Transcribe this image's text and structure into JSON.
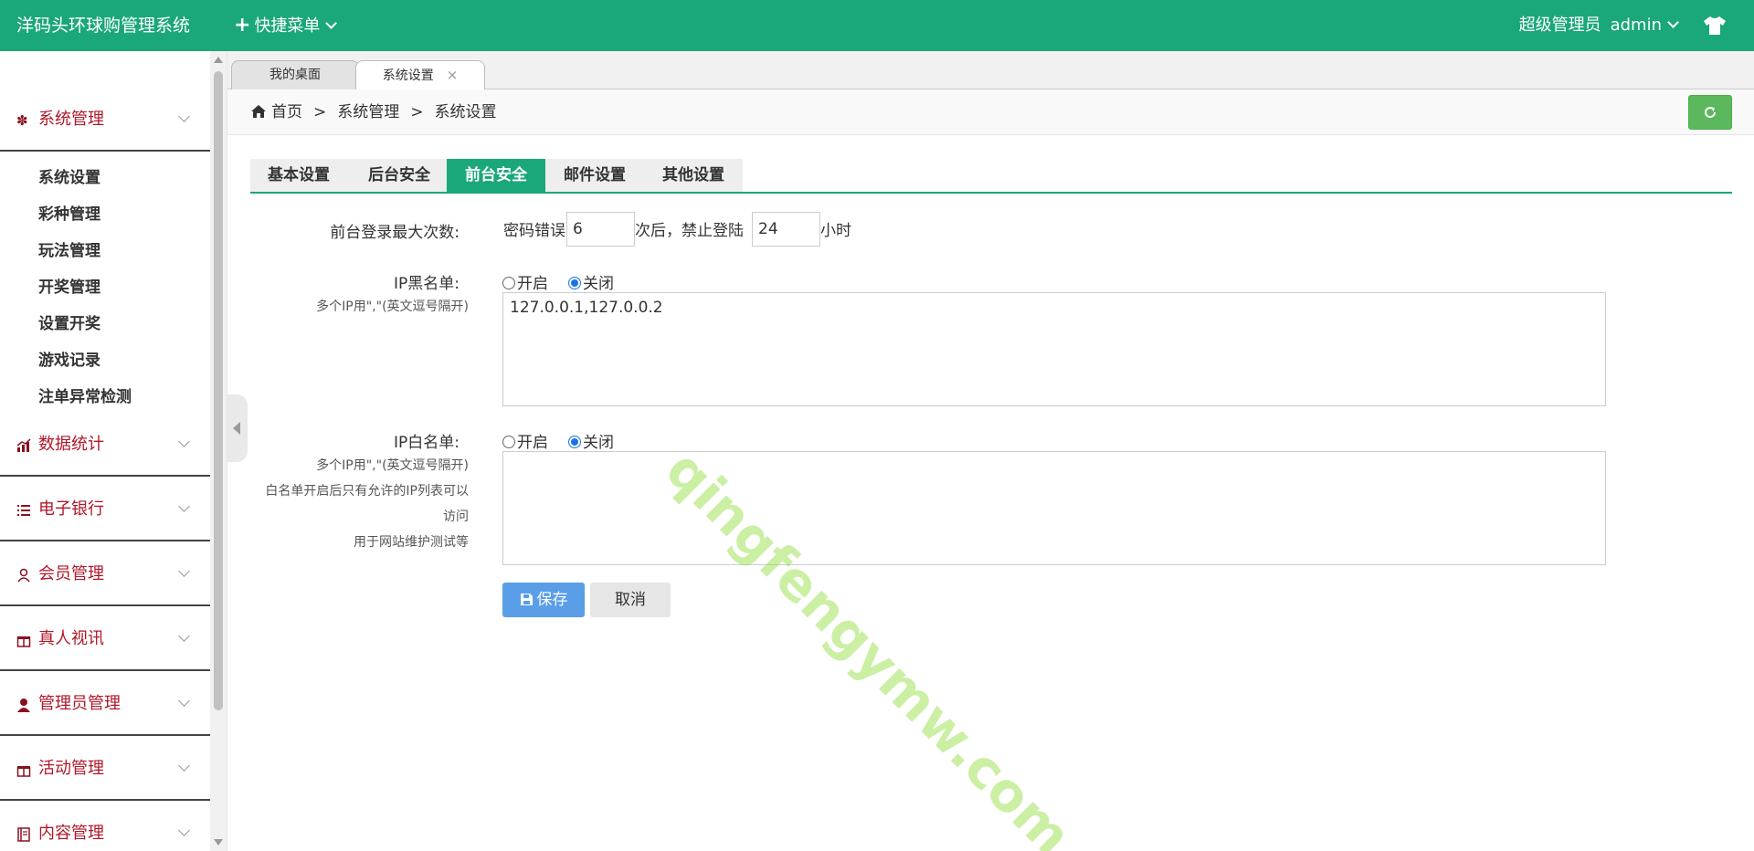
{
  "header": {
    "brand": "洋码头环球购管理系统",
    "quick_menu": "快捷菜单",
    "role": "超级管理员",
    "username": "admin",
    "accent": "#1aa77a"
  },
  "sidebar": {
    "groups": [
      {
        "label": "系统管理",
        "icon": "gear-icon"
      },
      {
        "label": "数据统计",
        "icon": "chart-icon"
      },
      {
        "label": "电子银行",
        "icon": "list-icon"
      },
      {
        "label": "会员管理",
        "icon": "user-icon"
      },
      {
        "label": "真人视讯",
        "icon": "gift-icon"
      },
      {
        "label": "管理员管理",
        "icon": "person-icon"
      },
      {
        "label": "活动管理",
        "icon": "gift-icon"
      },
      {
        "label": "内容管理",
        "icon": "book-icon"
      }
    ],
    "sub_items": [
      "系统设置",
      "彩种管理",
      "玩法管理",
      "开奖管理",
      "设置开奖",
      "游戏记录",
      "注单异常检测"
    ]
  },
  "tabs": [
    {
      "label": "我的桌面"
    },
    {
      "label": "系统设置",
      "close": "×"
    }
  ],
  "breadcrumb": {
    "home": "首页",
    "sep": ">",
    "level1": "系统管理",
    "level2": "系统设置"
  },
  "content_tabs": [
    "基本设置",
    "后台安全",
    "前台安全",
    "邮件设置",
    "其他设置"
  ],
  "form": {
    "login_max_label": "前台登录最大次数:",
    "pwd_error_prefix": "密码错误",
    "pwd_error_count": "6",
    "pwd_error_mid": "次后，禁止登陆",
    "ban_hours": "24",
    "ban_unit": "小时",
    "blacklist_label": "IP黑名单:",
    "blacklist_hint": "多个IP用\",\"(英文逗号隔开)",
    "blacklist_value": "127.0.0.1,127.0.0.2",
    "whitelist_label": "IP白名单:",
    "whitelist_hint1": "多个IP用\",\"(英文逗号隔开)",
    "whitelist_hint2": "白名单开启后只有允许的IP列表可以",
    "whitelist_hint3": "访问",
    "whitelist_hint4": "用于网站维护测试等",
    "whitelist_value": "",
    "radio_on": "开启",
    "radio_off": "关闭",
    "save": "保存",
    "cancel": "取消"
  },
  "watermark": "qingfengymw.com"
}
